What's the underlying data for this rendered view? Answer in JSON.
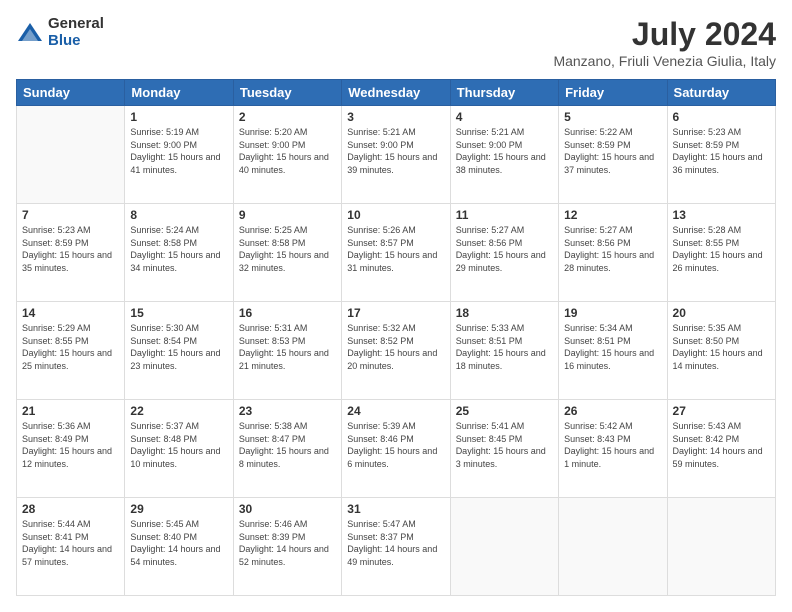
{
  "header": {
    "logo_general": "General",
    "logo_blue": "Blue",
    "month_year": "July 2024",
    "location": "Manzano, Friuli Venezia Giulia, Italy"
  },
  "days_of_week": [
    "Sunday",
    "Monday",
    "Tuesday",
    "Wednesday",
    "Thursday",
    "Friday",
    "Saturday"
  ],
  "weeks": [
    [
      {
        "day": "",
        "sunrise": "",
        "sunset": "",
        "daylight": "",
        "empty": true
      },
      {
        "day": "1",
        "sunrise": "5:19 AM",
        "sunset": "9:00 PM",
        "daylight": "15 hours and 41 minutes."
      },
      {
        "day": "2",
        "sunrise": "5:20 AM",
        "sunset": "9:00 PM",
        "daylight": "15 hours and 40 minutes."
      },
      {
        "day": "3",
        "sunrise": "5:21 AM",
        "sunset": "9:00 PM",
        "daylight": "15 hours and 39 minutes."
      },
      {
        "day": "4",
        "sunrise": "5:21 AM",
        "sunset": "9:00 PM",
        "daylight": "15 hours and 38 minutes."
      },
      {
        "day": "5",
        "sunrise": "5:22 AM",
        "sunset": "8:59 PM",
        "daylight": "15 hours and 37 minutes."
      },
      {
        "day": "6",
        "sunrise": "5:23 AM",
        "sunset": "8:59 PM",
        "daylight": "15 hours and 36 minutes."
      }
    ],
    [
      {
        "day": "7",
        "sunrise": "5:23 AM",
        "sunset": "8:59 PM",
        "daylight": "15 hours and 35 minutes."
      },
      {
        "day": "8",
        "sunrise": "5:24 AM",
        "sunset": "8:58 PM",
        "daylight": "15 hours and 34 minutes."
      },
      {
        "day": "9",
        "sunrise": "5:25 AM",
        "sunset": "8:58 PM",
        "daylight": "15 hours and 32 minutes."
      },
      {
        "day": "10",
        "sunrise": "5:26 AM",
        "sunset": "8:57 PM",
        "daylight": "15 hours and 31 minutes."
      },
      {
        "day": "11",
        "sunrise": "5:27 AM",
        "sunset": "8:56 PM",
        "daylight": "15 hours and 29 minutes."
      },
      {
        "day": "12",
        "sunrise": "5:27 AM",
        "sunset": "8:56 PM",
        "daylight": "15 hours and 28 minutes."
      },
      {
        "day": "13",
        "sunrise": "5:28 AM",
        "sunset": "8:55 PM",
        "daylight": "15 hours and 26 minutes."
      }
    ],
    [
      {
        "day": "14",
        "sunrise": "5:29 AM",
        "sunset": "8:55 PM",
        "daylight": "15 hours and 25 minutes."
      },
      {
        "day": "15",
        "sunrise": "5:30 AM",
        "sunset": "8:54 PM",
        "daylight": "15 hours and 23 minutes."
      },
      {
        "day": "16",
        "sunrise": "5:31 AM",
        "sunset": "8:53 PM",
        "daylight": "15 hours and 21 minutes."
      },
      {
        "day": "17",
        "sunrise": "5:32 AM",
        "sunset": "8:52 PM",
        "daylight": "15 hours and 20 minutes."
      },
      {
        "day": "18",
        "sunrise": "5:33 AM",
        "sunset": "8:51 PM",
        "daylight": "15 hours and 18 minutes."
      },
      {
        "day": "19",
        "sunrise": "5:34 AM",
        "sunset": "8:51 PM",
        "daylight": "15 hours and 16 minutes."
      },
      {
        "day": "20",
        "sunrise": "5:35 AM",
        "sunset": "8:50 PM",
        "daylight": "15 hours and 14 minutes."
      }
    ],
    [
      {
        "day": "21",
        "sunrise": "5:36 AM",
        "sunset": "8:49 PM",
        "daylight": "15 hours and 12 minutes."
      },
      {
        "day": "22",
        "sunrise": "5:37 AM",
        "sunset": "8:48 PM",
        "daylight": "15 hours and 10 minutes."
      },
      {
        "day": "23",
        "sunrise": "5:38 AM",
        "sunset": "8:47 PM",
        "daylight": "15 hours and 8 minutes."
      },
      {
        "day": "24",
        "sunrise": "5:39 AM",
        "sunset": "8:46 PM",
        "daylight": "15 hours and 6 minutes."
      },
      {
        "day": "25",
        "sunrise": "5:41 AM",
        "sunset": "8:45 PM",
        "daylight": "15 hours and 3 minutes."
      },
      {
        "day": "26",
        "sunrise": "5:42 AM",
        "sunset": "8:43 PM",
        "daylight": "15 hours and 1 minute."
      },
      {
        "day": "27",
        "sunrise": "5:43 AM",
        "sunset": "8:42 PM",
        "daylight": "14 hours and 59 minutes."
      }
    ],
    [
      {
        "day": "28",
        "sunrise": "5:44 AM",
        "sunset": "8:41 PM",
        "daylight": "14 hours and 57 minutes."
      },
      {
        "day": "29",
        "sunrise": "5:45 AM",
        "sunset": "8:40 PM",
        "daylight": "14 hours and 54 minutes."
      },
      {
        "day": "30",
        "sunrise": "5:46 AM",
        "sunset": "8:39 PM",
        "daylight": "14 hours and 52 minutes."
      },
      {
        "day": "31",
        "sunrise": "5:47 AM",
        "sunset": "8:37 PM",
        "daylight": "14 hours and 49 minutes."
      },
      {
        "day": "",
        "sunrise": "",
        "sunset": "",
        "daylight": "",
        "empty": true
      },
      {
        "day": "",
        "sunrise": "",
        "sunset": "",
        "daylight": "",
        "empty": true
      },
      {
        "day": "",
        "sunrise": "",
        "sunset": "",
        "daylight": "",
        "empty": true
      }
    ]
  ]
}
